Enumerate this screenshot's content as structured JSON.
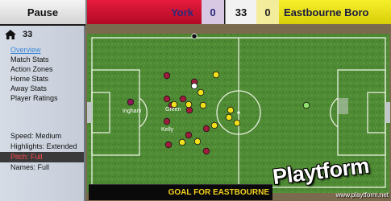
{
  "scoreboard": {
    "pause_label": "Pause",
    "home_team": "York",
    "home_score": "0",
    "minute": "33",
    "away_score": "0",
    "away_team": "Eastbourne Boro",
    "home_color": "#c8102e",
    "away_color": "#f2e81a"
  },
  "sidebar": {
    "minute": "33",
    "home_icon": "home-icon",
    "nav": [
      {
        "label": "Overview",
        "active": true
      },
      {
        "label": "Match Stats",
        "active": false
      },
      {
        "label": "Action Zones",
        "active": false
      },
      {
        "label": "Home Stats",
        "active": false
      },
      {
        "label": "Away Stats",
        "active": false
      },
      {
        "label": "Player Ratings",
        "active": false
      }
    ],
    "settings": [
      {
        "label": "Speed: Medium"
      },
      {
        "label": "Highlights: Extended"
      },
      {
        "label": "Pitch: Full"
      },
      {
        "label": "Names: Full"
      }
    ]
  },
  "pitch": {
    "grass_color": "#4f8a34",
    "players": [
      {
        "team": "away-gk"
      },
      {
        "team": "home-gk"
      },
      {
        "team": "home"
      },
      {
        "team": "home"
      },
      {
        "team": "home"
      },
      {
        "team": "home"
      },
      {
        "team": "home"
      },
      {
        "team": "home"
      },
      {
        "team": "home"
      },
      {
        "team": "home"
      },
      {
        "team": "home"
      },
      {
        "team": "home"
      },
      {
        "team": "home"
      },
      {
        "team": "away"
      },
      {
        "team": "away"
      },
      {
        "team": "away"
      },
      {
        "team": "away"
      },
      {
        "team": "away"
      },
      {
        "team": "away"
      },
      {
        "team": "away"
      },
      {
        "team": "away"
      },
      {
        "team": "away"
      },
      {
        "team": "away"
      },
      {
        "team": "away"
      }
    ],
    "names": [
      "Ingham",
      "Green",
      "Kelly"
    ]
  },
  "ticker": {
    "text": "GOAL FOR EASTBOURNE"
  },
  "watermark": {
    "logo": "Playtform",
    "url": "www.playtform.net"
  }
}
